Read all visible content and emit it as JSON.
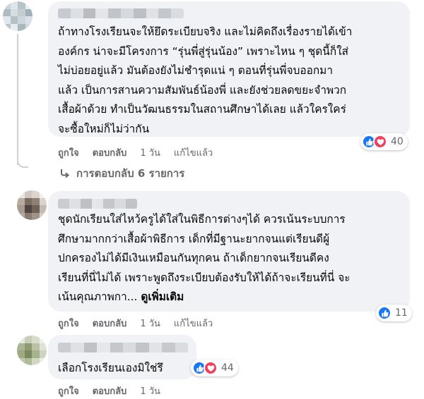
{
  "comments": [
    {
      "text": "ถ้าทางโรงเรียนจะให้ยึดระเบียบจริง และไม่คิดถึงเรื่องรายได้เข้า\nองค์กร น่าจะมีโครงการ “รุ่นพี่สู่รุ่นน้อง” เพราะไหน ๆ ชุดนี้ก็ใส่\nไม่บ่อยอยู่แล้ว มันต้องยังไม่ชำรุดแน่ ๆ ตอนที่รุ่นพี่จบออกมา\nแล้ว เป็นการสานความสัมพันธ์น้องพี่ และยังช่วยลดขยะจำพวก\nเสื้อผ้าด้วย ทำเป็นวัฒนธรรมในสถานศึกษาได้เลย แล้วใครใคร่\nจะซื้อใหม่ก็ไม่ว่ากัน",
      "actions": {
        "like": "ถูกใจ",
        "reply": "ตอบกลับ",
        "time": "1 วัน",
        "edited": "แก้ไขแล้ว"
      },
      "reaction_count": "40",
      "reactions": [
        "like",
        "love"
      ],
      "replies_label": "การตอบกลับ 6 รายการ"
    },
    {
      "text": "ชุดนักเรียนใส่ไหว้ครูได้ใส่ในพิธีการต่างๆได้ ควรเน้นระบบการ\nศึกษามากกว่าเสื้อผ้าพิธีการ เด็กที่มีฐานะยากจนแต่เรียนดีผู้\nปกครองไม่ได้มีเงินเหมือนกันทุกคน ถ้าเด็กยากจนเรียนดีคง\nเรียนที่นี่ไม่ได้ เพราะพูดถึงระเบียบต้องรับให้ได้ถ้าจะเรียนที่นี่ จะ\nเน้นคุณภาพกา... ",
      "see_more": "ดูเพิ่มเติม",
      "actions": {
        "like": "ถูกใจ",
        "reply": "ตอบกลับ",
        "time": "1 วัน",
        "edited": "แก้ไขแล้ว"
      },
      "reaction_count": "11",
      "reactions": [
        "like"
      ]
    },
    {
      "text": "เลือกโรงเรียนเองมิใช่รึ",
      "actions": {
        "like": "ถูกใจ",
        "reply": "ตอบกลับ",
        "time": "1 วัน"
      },
      "reaction_count": "44",
      "reactions": [
        "like",
        "love"
      ]
    }
  ],
  "colors": {
    "bubble": "#f0f2f5",
    "like": "#1877f2",
    "love": "#f33e58",
    "meta": "#65676b"
  }
}
